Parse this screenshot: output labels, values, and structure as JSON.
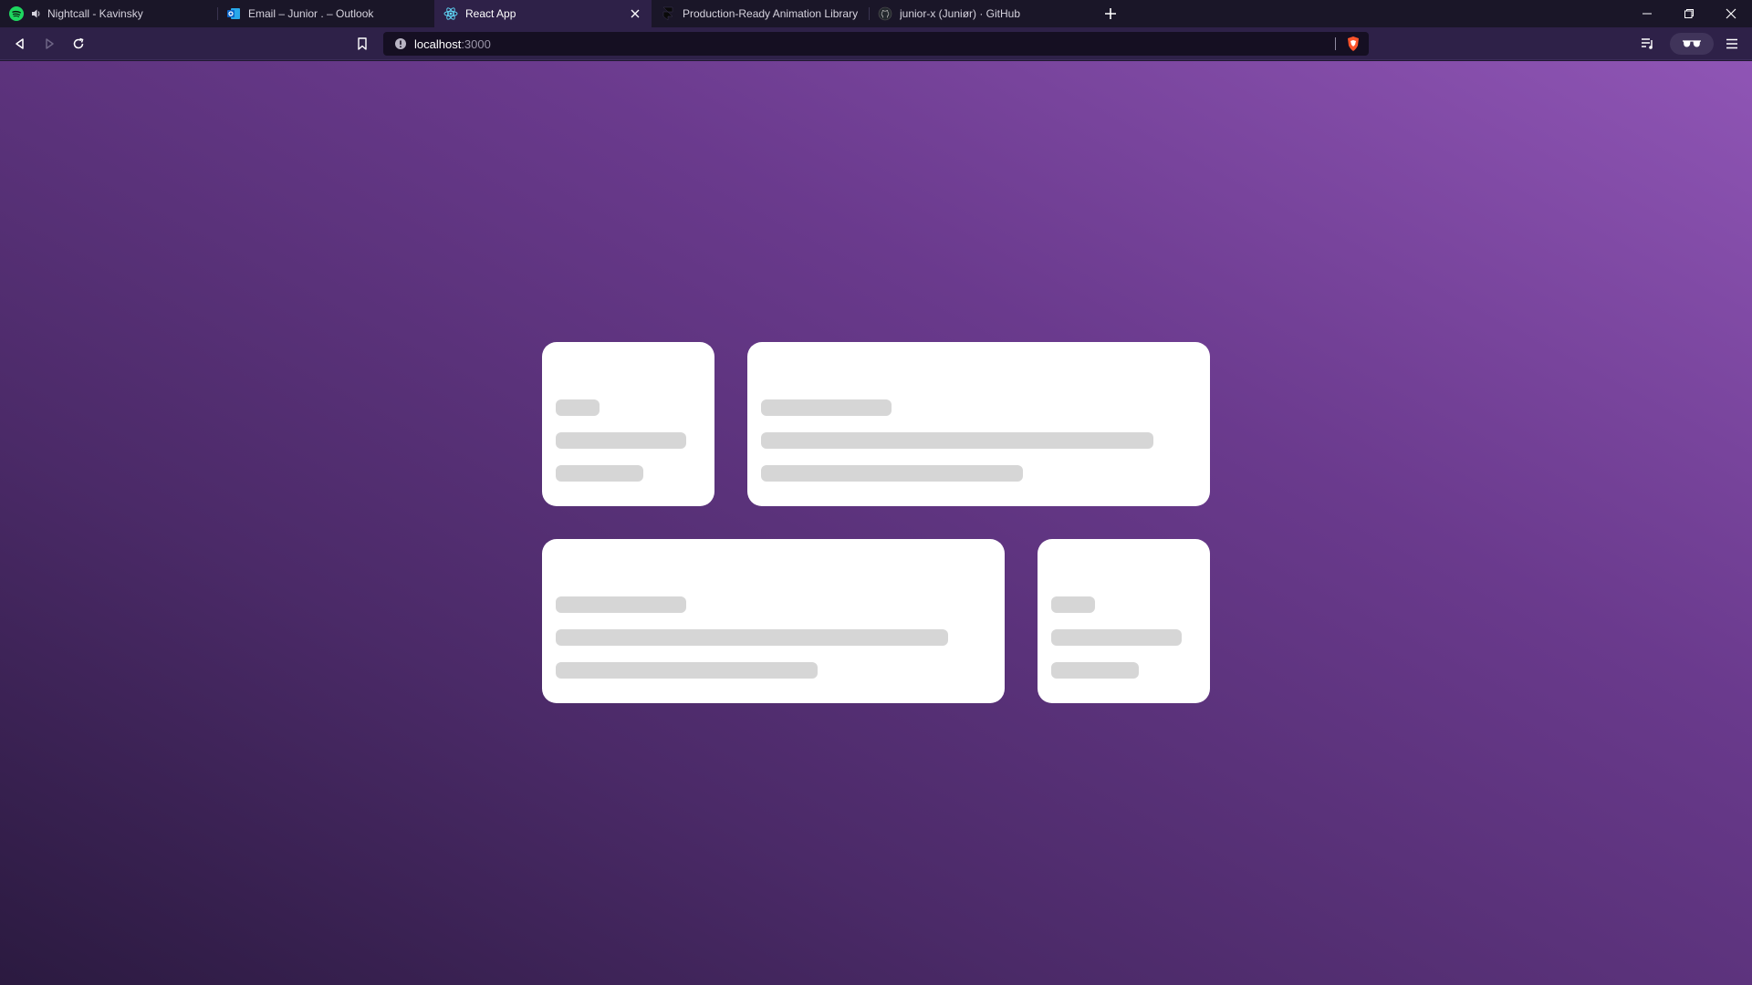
{
  "tabs": [
    {
      "title": "Nightcall - Kavinsky",
      "favicon": "spotify-icon",
      "audio": true,
      "active": false
    },
    {
      "title": "Email – Junior . – Outlook",
      "favicon": "outlook-icon",
      "audio": false,
      "active": false
    },
    {
      "title": "React App",
      "favicon": "react-icon",
      "audio": false,
      "active": true
    },
    {
      "title": "Production-Ready Animation Library f",
      "favicon": "framer-icon",
      "audio": false,
      "active": false
    },
    {
      "title": "junior-x (Juniør) · GitHub",
      "favicon": "github-icon",
      "audio": false,
      "active": false
    }
  ],
  "address_bar": {
    "host": "localhost",
    "port": ":3000"
  },
  "colors": {
    "tabstrip_bg": "#1a1628",
    "toolbar_bg": "#2e2148",
    "viewport_gradient_start": "#2b1a40",
    "viewport_gradient_end": "#8f55b5",
    "card_bg": "#ffffff",
    "skeleton": "#d6d6d6"
  },
  "page": {
    "cards": [
      {
        "name": "card-small-top",
        "skeleton_lines": 3
      },
      {
        "name": "card-wide-top",
        "skeleton_lines": 3
      },
      {
        "name": "card-wide-bottom",
        "skeleton_lines": 3
      },
      {
        "name": "card-small-bottom",
        "skeleton_lines": 3
      }
    ]
  }
}
